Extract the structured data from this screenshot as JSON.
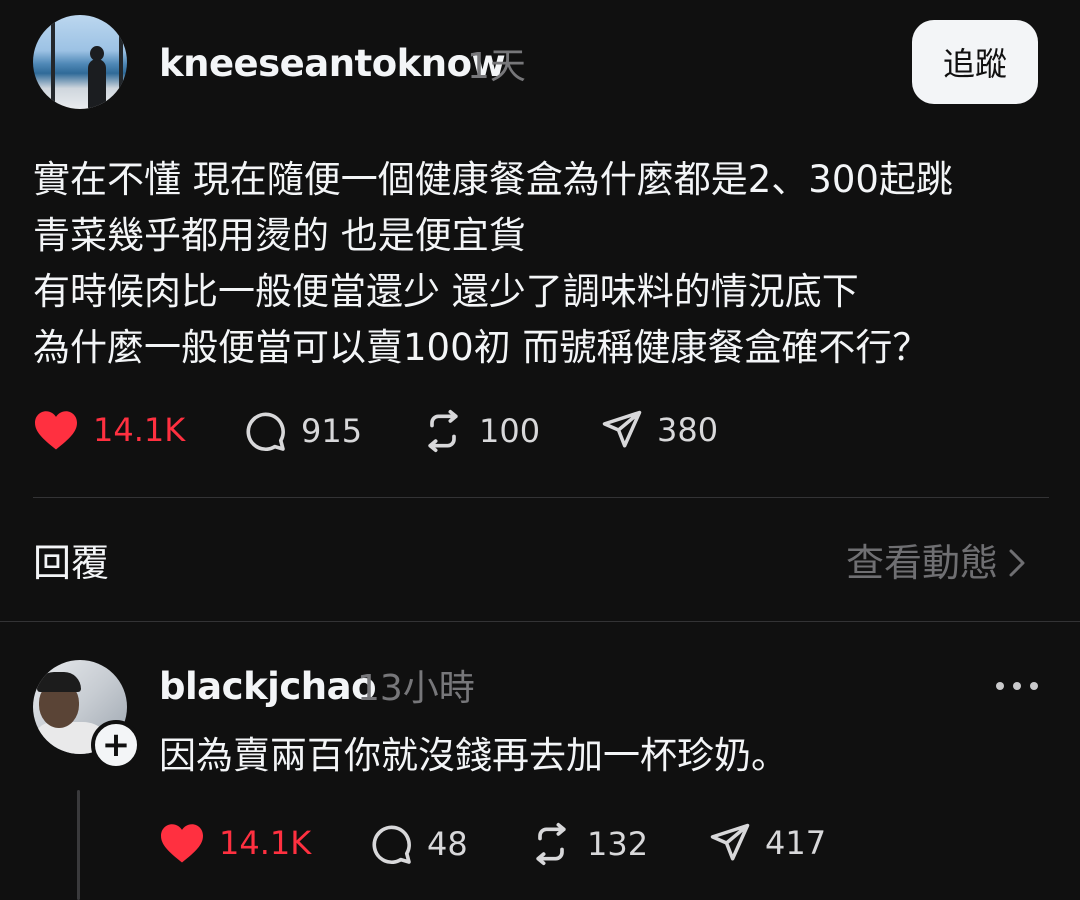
{
  "post": {
    "username": "kneeseantoknow",
    "time": "1天",
    "follow_label": "追蹤",
    "lines": [
      "實在不懂 現在隨便一個健康餐盒為什麼都是2、300起跳",
      "青菜幾乎都用燙的 也是便宜貨",
      "有時候肉比一般便當還少 還少了調味料的情況底下",
      "為什麼一般便當可以賣100初 而號稱健康餐盒確不行？"
    ],
    "likes": "14.1K",
    "comments": "915",
    "reposts": "100",
    "shares": "380"
  },
  "replies_section": {
    "label": "回覆",
    "view_activity": "查看動態"
  },
  "reply": {
    "username": "blackjchao",
    "time": "13小時",
    "text": "因為賣兩百你就沒錢再去加一杯珍奶。",
    "likes": "14.1K",
    "comments": "48",
    "reposts": "132",
    "shares": "417"
  },
  "colors": {
    "background": "#101010",
    "like_red": "#ff3040",
    "muted": "#77777a"
  },
  "icons": [
    "heart-icon",
    "comment-icon",
    "repost-icon",
    "share-icon",
    "chevron-right-icon",
    "more-icon",
    "plus-icon"
  ]
}
